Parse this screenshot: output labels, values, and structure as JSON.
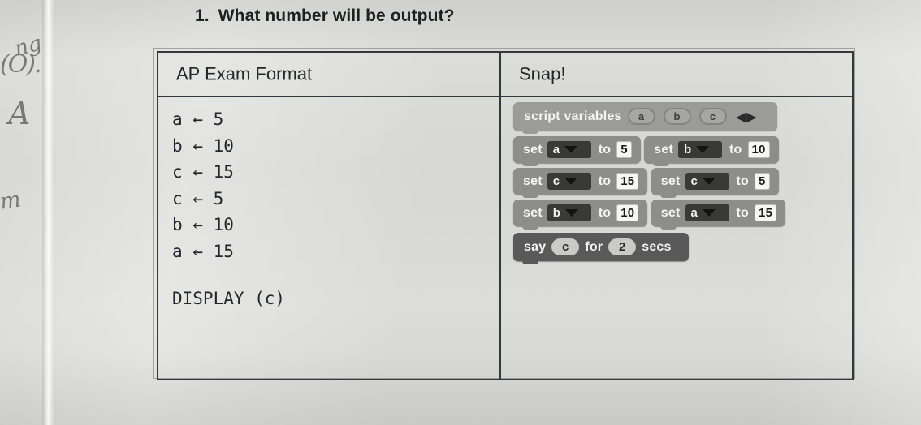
{
  "question": {
    "number": "1.",
    "text": "What number will be output?"
  },
  "margin_notes": {
    "note_1": "ng",
    "note_2": "(O).",
    "note_3": "A",
    "note_4": "m"
  },
  "table": {
    "headers": {
      "left": "AP Exam Format",
      "right": "Snap!"
    },
    "pseudocode": [
      {
        "var": "a",
        "arrow": "←",
        "value": "5"
      },
      {
        "var": "b",
        "arrow": "←",
        "value": "10"
      },
      {
        "var": "c",
        "arrow": "←",
        "value": "15"
      },
      {
        "var": "c",
        "arrow": "←",
        "value": "5"
      },
      {
        "var": "b",
        "arrow": "←",
        "value": "10"
      },
      {
        "var": "a",
        "arrow": "←",
        "value": "15"
      }
    ],
    "display_statement": "DISPLAY (c)"
  },
  "snap_script": {
    "script_variables_block": {
      "label": "script variables",
      "variables": [
        "a",
        "b",
        "c"
      ],
      "left_arrow": "◀",
      "right_arrow": "▶"
    },
    "set_blocks": [
      {
        "keyword": "set",
        "variable": "a",
        "to": "to",
        "value": "5"
      },
      {
        "keyword": "set",
        "variable": "b",
        "to": "to",
        "value": "10"
      },
      {
        "keyword": "set",
        "variable": "c",
        "to": "to",
        "value": "15"
      },
      {
        "keyword": "set",
        "variable": "c",
        "to": "to",
        "value": "5"
      },
      {
        "keyword": "set",
        "variable": "b",
        "to": "to",
        "value": "10"
      },
      {
        "keyword": "set",
        "variable": "a",
        "to": "to",
        "value": "15"
      }
    ],
    "say_block": {
      "keyword": "say",
      "message": "c",
      "for_label": "for",
      "seconds": "2",
      "secs_label": "secs"
    }
  },
  "colors": {
    "paper": "#d9d9d6",
    "table_border": "#33383b",
    "text": "#23262a",
    "variables_block": "#9a9a98",
    "set_block": "#8d8d8b",
    "say_block": "#5a5a5a",
    "dropdown": "#3a3a38",
    "input_field": "#f4f4f2"
  }
}
